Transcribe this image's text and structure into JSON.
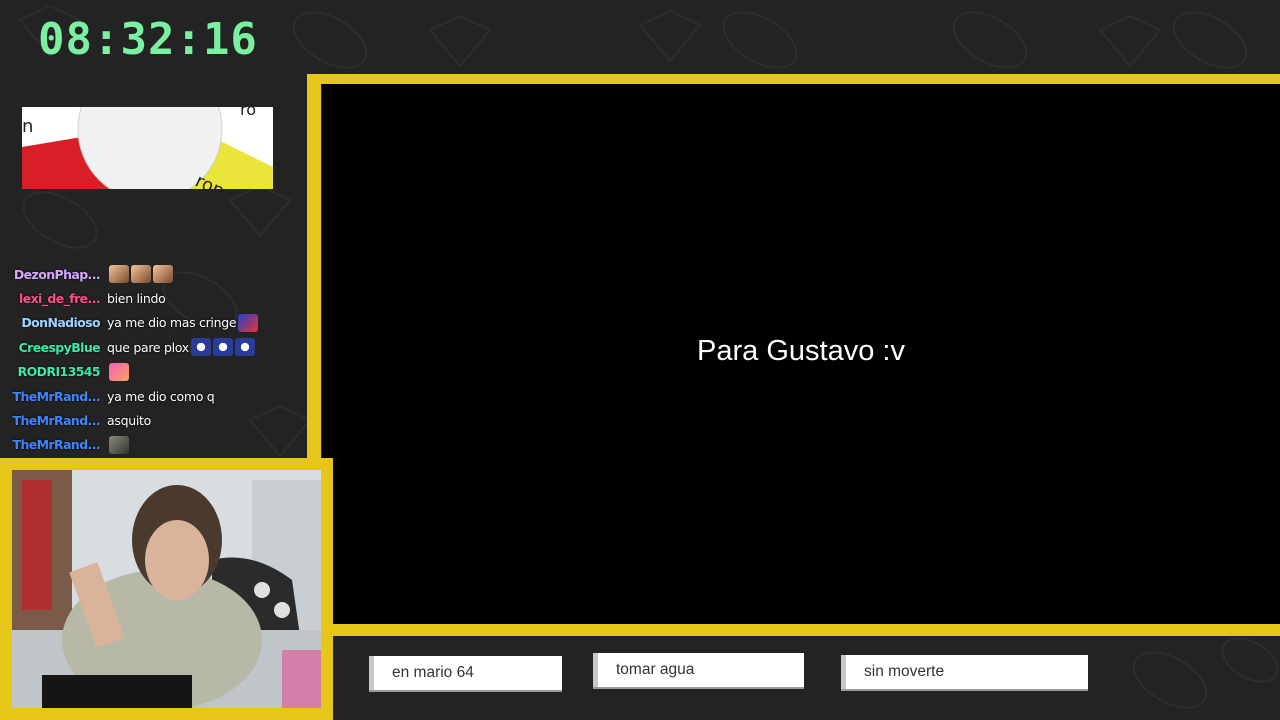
{
  "clock": {
    "time": "08:32:16"
  },
  "chat": {
    "messages": [
      {
        "user": "DezonPhap...",
        "text": "",
        "user_color": "#d7a6ff",
        "emotes": [
          "face",
          "face",
          "face"
        ]
      },
      {
        "user": "lexi_de_fre...",
        "text": "bien lindo",
        "user_color": "#ff4f8a",
        "emotes": []
      },
      {
        "user": "DonNadioso",
        "text": "ya me dio mas cringe",
        "user_color": "#9fd3ff",
        "emotes": [
          "sonic"
        ]
      },
      {
        "user": "CreespyBlue",
        "text": "que pare plox",
        "user_color": "#3ee8a5",
        "emotes": [
          "scared",
          "scared",
          "scared"
        ]
      },
      {
        "user": "RODRI13545",
        "text": "",
        "user_color": "#3ee8a5",
        "emotes": [
          "pink"
        ]
      },
      {
        "user": "TheMrRand...",
        "text": "ya me dio como q",
        "user_color": "#3c86ff",
        "emotes": []
      },
      {
        "user": "TheMrRand...",
        "text": "asquito",
        "user_color": "#3c86ff",
        "emotes": []
      },
      {
        "user": "TheMrRand...",
        "text": "",
        "user_color": "#3c86ff",
        "emotes": [
          "cat"
        ]
      }
    ]
  },
  "main": {
    "caption": "Para Gustavo :v"
  },
  "labels": {
    "left": "en mario 64",
    "middle": "tomar agua",
    "right": "sin moverte"
  },
  "colors": {
    "frame": "#e7c61a",
    "background": "#232323",
    "clock": "#7af0a0"
  }
}
